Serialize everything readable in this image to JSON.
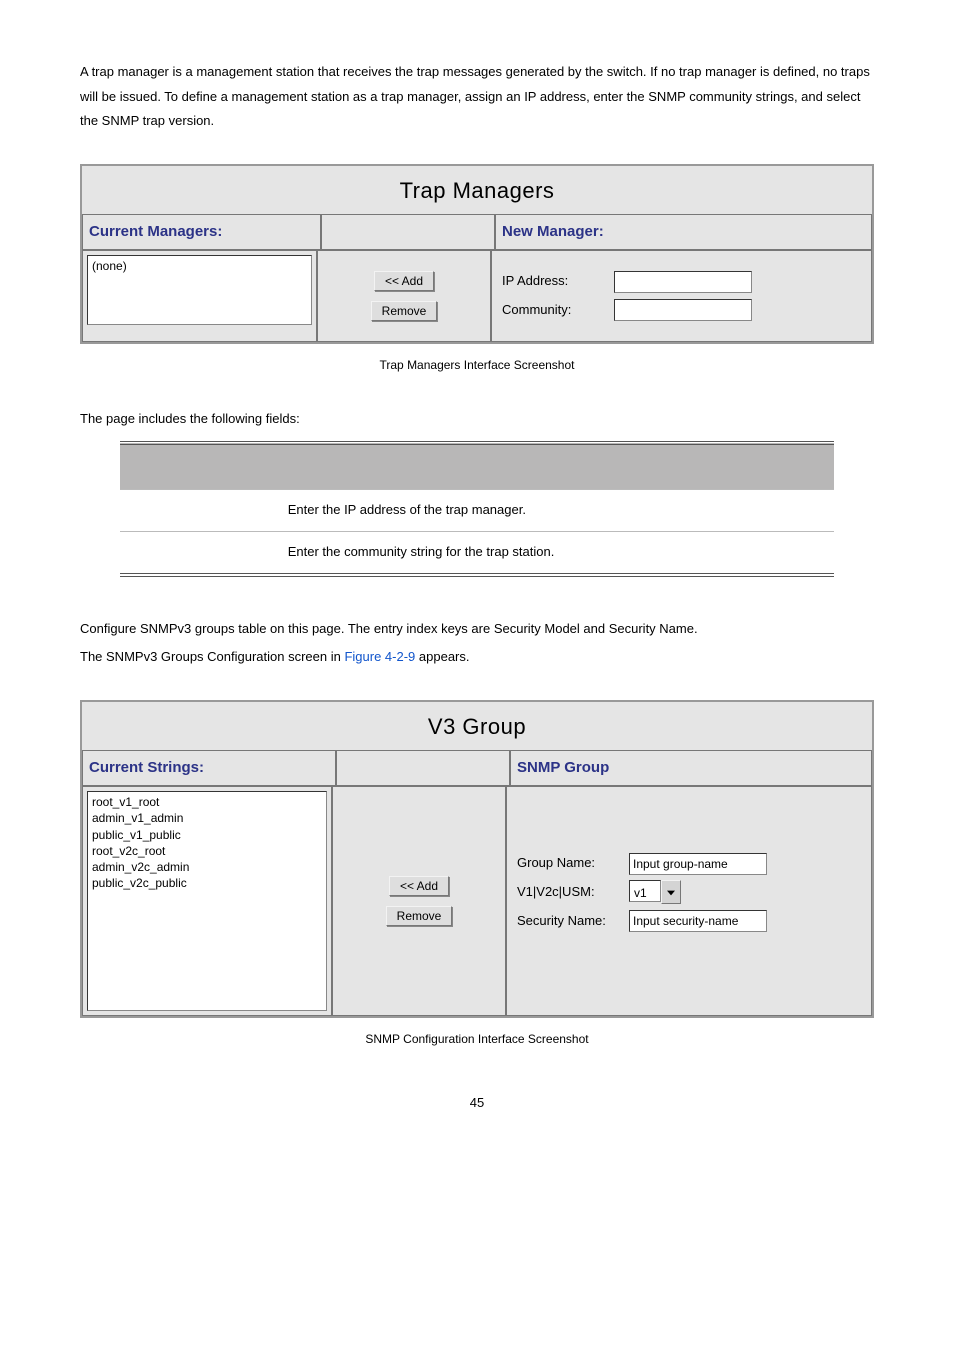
{
  "intro_text": "A trap manager is a management station that receives the trap messages generated by the switch. If no trap manager is defined, no traps will be issued. To define a management station as a trap manager, assign an IP address, enter the SNMP community strings, and select the SNMP trap version.",
  "trap_panel": {
    "title": "Trap Managers",
    "left_header": "Current Managers:",
    "right_header": "New Manager:",
    "list_items": [
      "(none)"
    ],
    "add_btn": "<< Add",
    "remove_btn": "Remove",
    "ip_label": "IP Address:",
    "community_label": "Community:"
  },
  "caption1": "Trap Managers Interface Screenshot",
  "fields_intro": "The page includes the following fields:",
  "fields_table": {
    "rows": [
      {
        "desc": "Enter the IP address of the trap manager."
      },
      {
        "desc": "Enter the community string for the trap station."
      }
    ]
  },
  "v3_intro1": "Configure SNMPv3 groups table on this page. The entry index keys are Security Model and Security Name.",
  "v3_intro2_a": "The SNMPv3 Groups Configuration screen in ",
  "v3_intro2_link": "Figure 4-2-9",
  "v3_intro2_b": " appears.",
  "v3_panel": {
    "title": "V3 Group",
    "left_header": "Current Strings:",
    "right_header": "SNMP Group",
    "list_items": [
      "root_v1_root",
      "admin_v1_admin",
      "public_v1_public",
      "root_v2c_root",
      "admin_v2c_admin",
      "public_v2c_public"
    ],
    "add_btn": "<< Add",
    "remove_btn": "Remove",
    "group_name_label": "Group Name:",
    "group_name_placeholder": "Input group-name",
    "usm_label": "V1|V2c|USM:",
    "usm_value": "v1",
    "security_name_label": "Security Name:",
    "security_name_placeholder": "Input security-name"
  },
  "caption2": "SNMP Configuration Interface Screenshot",
  "page_number": "45"
}
